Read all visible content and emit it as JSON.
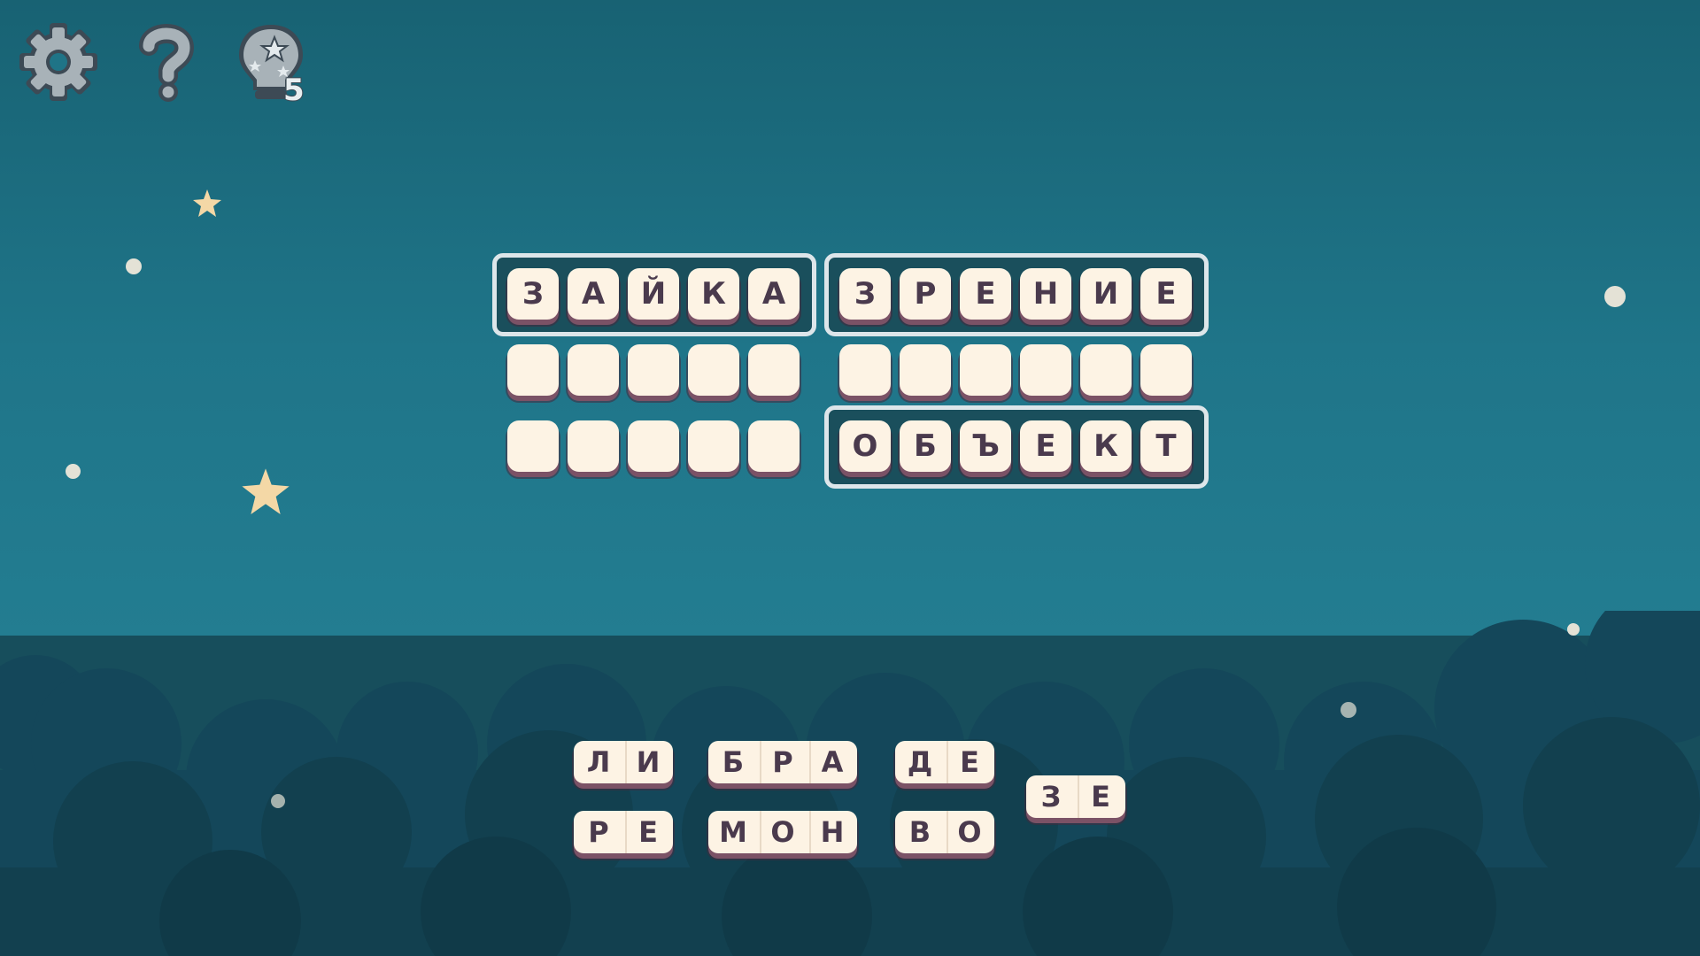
{
  "toolbar": {
    "settings_icon": "gear-icon",
    "help_icon": "question-mark-icon",
    "hints_icon": "lightbulb-stars-icon",
    "hints_count": "5"
  },
  "board": {
    "words": [
      {
        "letters": [
          "З",
          "А",
          "Й",
          "К",
          "А"
        ],
        "solved": true
      },
      {
        "letters": [
          "З",
          "Р",
          "Е",
          "Н",
          "И",
          "Е"
        ],
        "solved": true
      },
      {
        "letters": [
          "",
          "",
          "",
          "",
          ""
        ],
        "solved": false
      },
      {
        "letters": [
          "",
          "",
          "",
          "",
          "",
          ""
        ],
        "solved": false
      },
      {
        "letters": [
          "",
          "",
          "",
          "",
          ""
        ],
        "solved": false
      },
      {
        "letters": [
          "О",
          "Б",
          "Ъ",
          "Е",
          "К",
          "Т"
        ],
        "solved": true
      }
    ]
  },
  "pieces": [
    [
      "Л",
      "И"
    ],
    [
      "Б",
      "Р",
      "А"
    ],
    [
      "Д",
      "Е"
    ],
    [
      "З",
      "Е"
    ],
    [
      "Р",
      "Е"
    ],
    [
      "М",
      "О",
      "Н"
    ],
    [
      "В",
      "О"
    ]
  ],
  "colors": {
    "sky": "#1f7589",
    "ground": "#174e5c",
    "tile": "#fdf3e4",
    "tile_text": "#4a3a4d",
    "frame": "#dde6ea"
  }
}
